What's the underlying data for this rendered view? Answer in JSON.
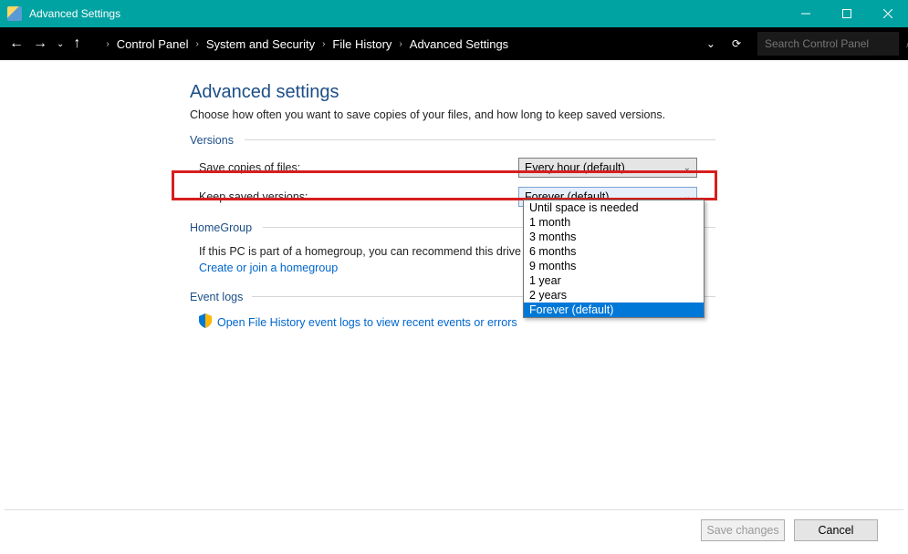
{
  "window": {
    "title": "Advanced Settings"
  },
  "breadcrumb": {
    "items": [
      "Control Panel",
      "System and Security",
      "File History",
      "Advanced Settings"
    ]
  },
  "search": {
    "placeholder": "Search Control Panel"
  },
  "page": {
    "heading": "Advanced settings",
    "description": "Choose how often you want to save copies of your files, and how long to keep saved versions."
  },
  "versions": {
    "legend": "Versions",
    "save_copies_label": "Save copies of files:",
    "save_copies_value": "Every hour (default)",
    "keep_label": "Keep saved versions:",
    "keep_value": "Forever (default)",
    "keep_options": [
      "Until space is needed",
      "1 month",
      "3 months",
      "6 months",
      "9 months",
      "1 year",
      "2 years",
      "Forever (default)"
    ],
    "keep_selected_index": 7
  },
  "homegroup": {
    "legend": "HomeGroup",
    "text": "If this PC is part of a homegroup, you can recommend this drive to",
    "link": "Create or join a homegroup"
  },
  "eventlogs": {
    "legend": "Event logs",
    "link": "Open File History event logs to view recent events or errors"
  },
  "buttons": {
    "save": "Save changes",
    "cancel": "Cancel"
  }
}
